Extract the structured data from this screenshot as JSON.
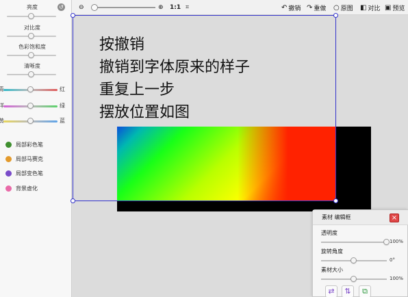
{
  "adjustments": [
    {
      "label": "亮度",
      "level": 0.5
    },
    {
      "label": "对比度",
      "level": 0.5
    },
    {
      "label": "色彩饱和度",
      "level": 0.5
    },
    {
      "label": "清晰度",
      "level": 0.5
    }
  ],
  "color_balance": [
    {
      "left": "青",
      "right": "红",
      "level": 0.5,
      "colors": [
        "#2fb9c9",
        "#e05a5a"
      ]
    },
    {
      "left": "洋",
      "right": "绿",
      "level": 0.5,
      "colors": [
        "#d461d8",
        "#5bd16a"
      ]
    },
    {
      "left": "黄",
      "right": "蓝",
      "level": 0.5,
      "colors": [
        "#e8d65a",
        "#5fa4e8"
      ]
    }
  ],
  "tools": [
    {
      "label": "局部彩色笔",
      "icon": "color-pen-icon",
      "color": "#3f8f2f"
    },
    {
      "label": "局部马赛克",
      "icon": "mosaic-icon",
      "color": "#e39a2c"
    },
    {
      "label": "局部变色笔",
      "icon": "recolor-pen-icon",
      "color": "#7a4cc9"
    },
    {
      "label": "背景虚化",
      "icon": "blur-icon",
      "color": "#e96aa8"
    }
  ],
  "toolbar": {
    "zoom_out_icon": "zoom-out-icon",
    "zoom_in_icon": "zoom-in-icon",
    "zoom_level": 0.0,
    "actual_size": "1:1",
    "undo": "撤销",
    "redo": "重做",
    "original": "原图",
    "compare": "对比",
    "preview": "预览"
  },
  "canvas": {
    "lines": [
      "按撤销",
      "撤销到字体原来的样子",
      "重复上一步",
      "摆放位置如图"
    ]
  },
  "material_panel": {
    "title": "素材 编辑框",
    "opacity_label": "透明度",
    "opacity_value": "100%",
    "opacity_level": 1.0,
    "rotate_label": "旋转角度",
    "rotate_value": "0°",
    "rotate_level": 0.5,
    "size_label": "素材大小",
    "size_value": "100%",
    "size_level": 0.5
  },
  "colors": {
    "frame_border": "#3333cc",
    "close_button": "#e04848"
  }
}
